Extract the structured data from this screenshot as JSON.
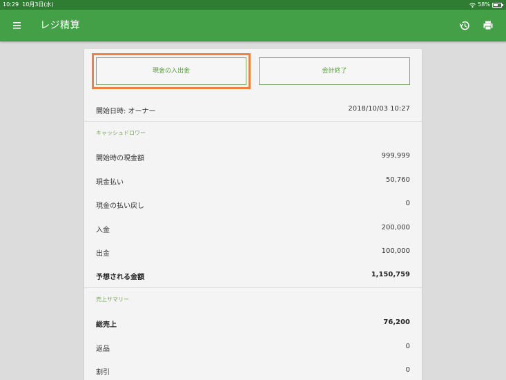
{
  "status_bar": {
    "time": "10:29",
    "date": "10月3日(水)",
    "battery": "58%",
    "battery_level": 0.58
  },
  "app_bar": {
    "title": "レジ精算",
    "background": "#43a047"
  },
  "buttons": {
    "deposit_label": "現金の入出金",
    "close_label": "会計終了"
  },
  "start": {
    "label": "開始日時: オーナー",
    "value": "2018/10/03 10:27"
  },
  "cash_drawer": {
    "title": "キャッシュドロワー",
    "items": [
      {
        "label": "開始時の現金額",
        "value": "999,999"
      },
      {
        "label": "現金払い",
        "value": "50,760"
      },
      {
        "label": "現金の払い戻し",
        "value": "0"
      },
      {
        "label": "入金",
        "value": "200,000"
      },
      {
        "label": "出金",
        "value": "100,000"
      },
      {
        "label": "予想される金額",
        "value": "1,150,759"
      }
    ]
  },
  "sales_summary": {
    "title": "売上サマリー",
    "items": [
      {
        "label": "総売上",
        "value": "76,200"
      },
      {
        "label": "返品",
        "value": "0"
      },
      {
        "label": "割引",
        "value": "0"
      }
    ]
  },
  "colors": {
    "accent": "#43a047",
    "status_bar": "#2e7d32",
    "highlight": "#f08040"
  }
}
